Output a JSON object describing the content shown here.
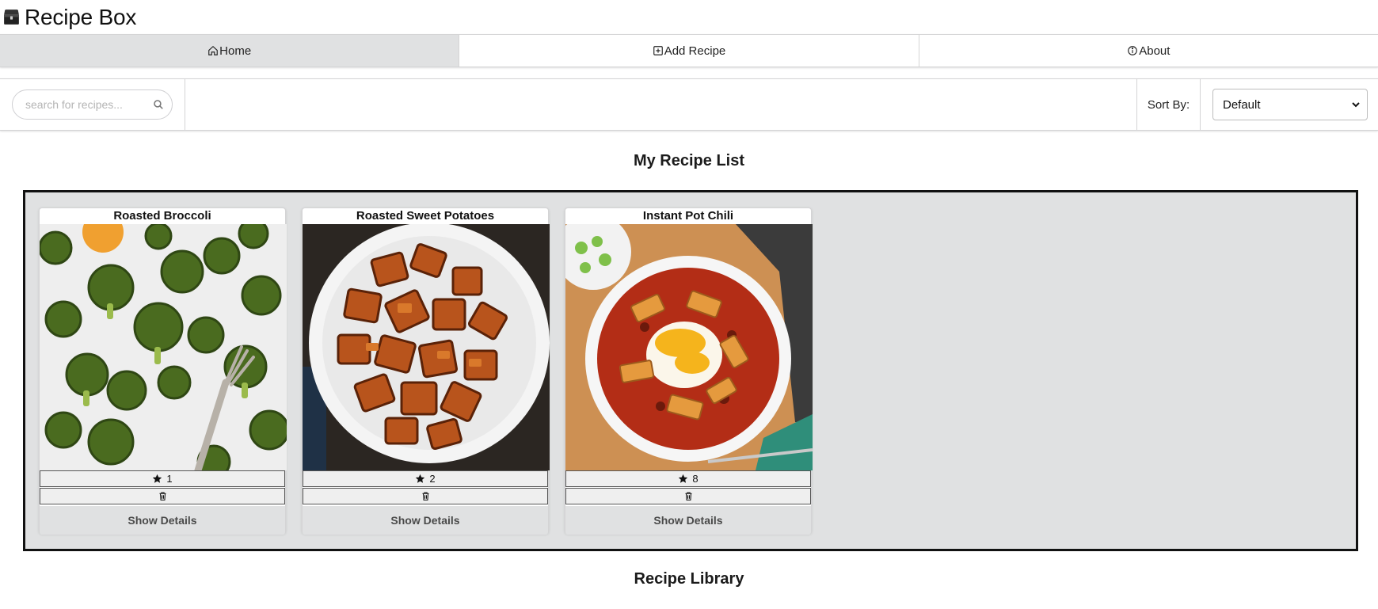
{
  "app": {
    "title": "Recipe Box",
    "logo_icon": "recipe-box-chest-icon"
  },
  "nav": {
    "tabs": [
      {
        "label": "Home",
        "icon": "home-icon",
        "active": true
      },
      {
        "label": "Add Recipe",
        "icon": "plus-square-icon",
        "active": false
      },
      {
        "label": "About",
        "icon": "info-circle-icon",
        "active": false
      }
    ]
  },
  "search": {
    "placeholder": "search for recipes...",
    "value": ""
  },
  "sort": {
    "label": "Sort By:",
    "selected": "Default"
  },
  "sections": {
    "my_list": "My Recipe List",
    "library": "Recipe Library"
  },
  "recipes": [
    {
      "title": "Roasted Broccoli",
      "rating": "1",
      "details_label": "Show Details"
    },
    {
      "title": "Roasted Sweet Potatoes",
      "rating": "2",
      "details_label": "Show Details"
    },
    {
      "title": "Instant Pot Chili",
      "rating": "8",
      "details_label": "Show Details"
    }
  ],
  "colors": {
    "active_tab": "#e0e1e2",
    "list_background": "#e0e1e2",
    "list_border": "#111111"
  }
}
